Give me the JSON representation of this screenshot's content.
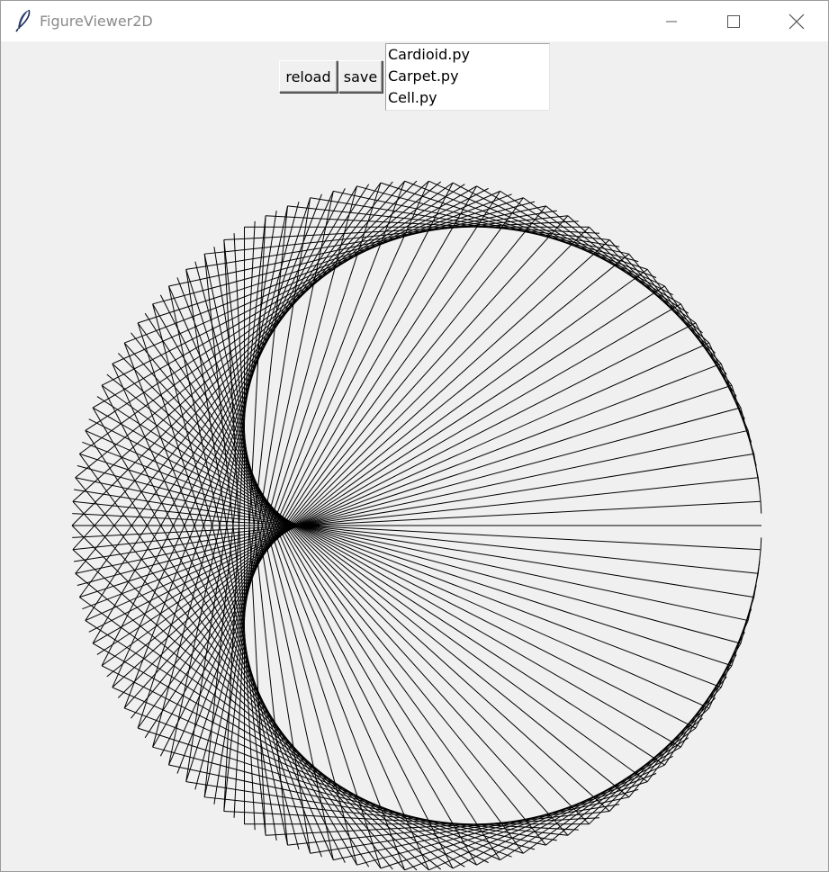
{
  "window": {
    "title": "FigureViewer2D",
    "icon": "feather-icon",
    "controls": [
      "minimize-icon",
      "maximize-icon",
      "close-icon"
    ]
  },
  "toolbar": {
    "reload_label": "reload",
    "save_label": "save"
  },
  "file_list": {
    "items": [
      "Cardioid.py",
      "Carpet.py",
      "Cell.py"
    ]
  },
  "figure": {
    "type": "cardioid-chord-drawing",
    "line_count": 180,
    "multiplier": 2,
    "stroke_color": "#000000",
    "background_color": "#f0f0f0"
  }
}
